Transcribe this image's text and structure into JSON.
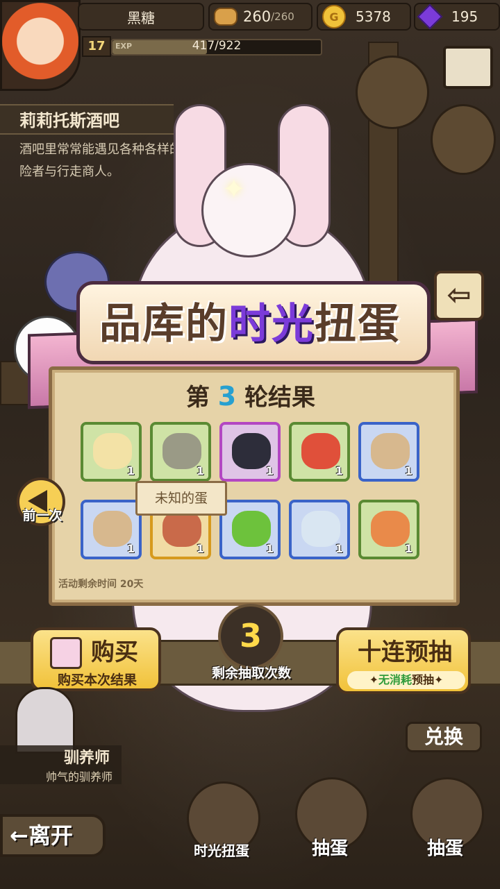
{
  "header": {
    "player_name": "黑糖",
    "level": "17",
    "exp_tag": "EXP",
    "exp_text": "417/922",
    "exp_ratio": 0.452,
    "stamina_value": "260",
    "stamina_max": "/260",
    "gold": "5378",
    "gems": "195",
    "gold_icon_letter": "G"
  },
  "location": {
    "title": "莉莉托斯酒吧",
    "description_line1": "酒吧里常常能遇见各种各样的冒",
    "description_line2": "险者与行走商人。"
  },
  "banner": {
    "title_part1": "品库的",
    "title_highlight": "时光",
    "title_part2": "扭蛋"
  },
  "results": {
    "round_prefix": "第",
    "round_number": "3",
    "round_suffix": "轮结果",
    "tooltip": "未知的蛋",
    "time_left": "活动剩余时间  20天",
    "items": [
      {
        "icon": "bread-bun-icon",
        "count": "1",
        "rarity": "green"
      },
      {
        "icon": "dried-leaf-icon",
        "count": "1",
        "rarity": "green"
      },
      {
        "icon": "anubis-mask-icon",
        "count": "1",
        "rarity": "purple"
      },
      {
        "icon": "red-crab-icon",
        "count": "1",
        "rarity": "green"
      },
      {
        "icon": "fur-boots-icon",
        "count": "1",
        "rarity": "blue"
      },
      {
        "icon": "fur-boots-icon",
        "count": "1",
        "rarity": "blue"
      },
      {
        "icon": "unknown-egg-item-icon",
        "count": "1",
        "rarity": "gold"
      },
      {
        "icon": "green-egg-icon",
        "count": "1",
        "rarity": "blue"
      },
      {
        "icon": "silver-shell-icon",
        "count": "1",
        "rarity": "blue"
      },
      {
        "icon": "orange-creature-icon",
        "count": "1",
        "rarity": "green"
      }
    ]
  },
  "controls": {
    "prev_label": "前一次",
    "buy_label": "购买",
    "buy_sub": "购买本次结果",
    "remaining_count": "3",
    "remaining_label": "剩余抽取次数",
    "ten_label": "十连预抽",
    "ten_sub_green": "无消耗",
    "ten_sub_rest": "预抽"
  },
  "bottom": {
    "trainer_name": "驯养师",
    "trainer_sub": "帅气的驯养师",
    "leave_label": "←离开",
    "exchange_label": "兑换",
    "nav_gacha": "时光扭蛋",
    "nav_draw_gem": "抽蛋",
    "nav_draw_gold": "抽蛋"
  },
  "colors": {
    "accent_purple": "#7b3bd9",
    "button_yellow": "#f1c23a",
    "round_number": "#27a0d0"
  }
}
